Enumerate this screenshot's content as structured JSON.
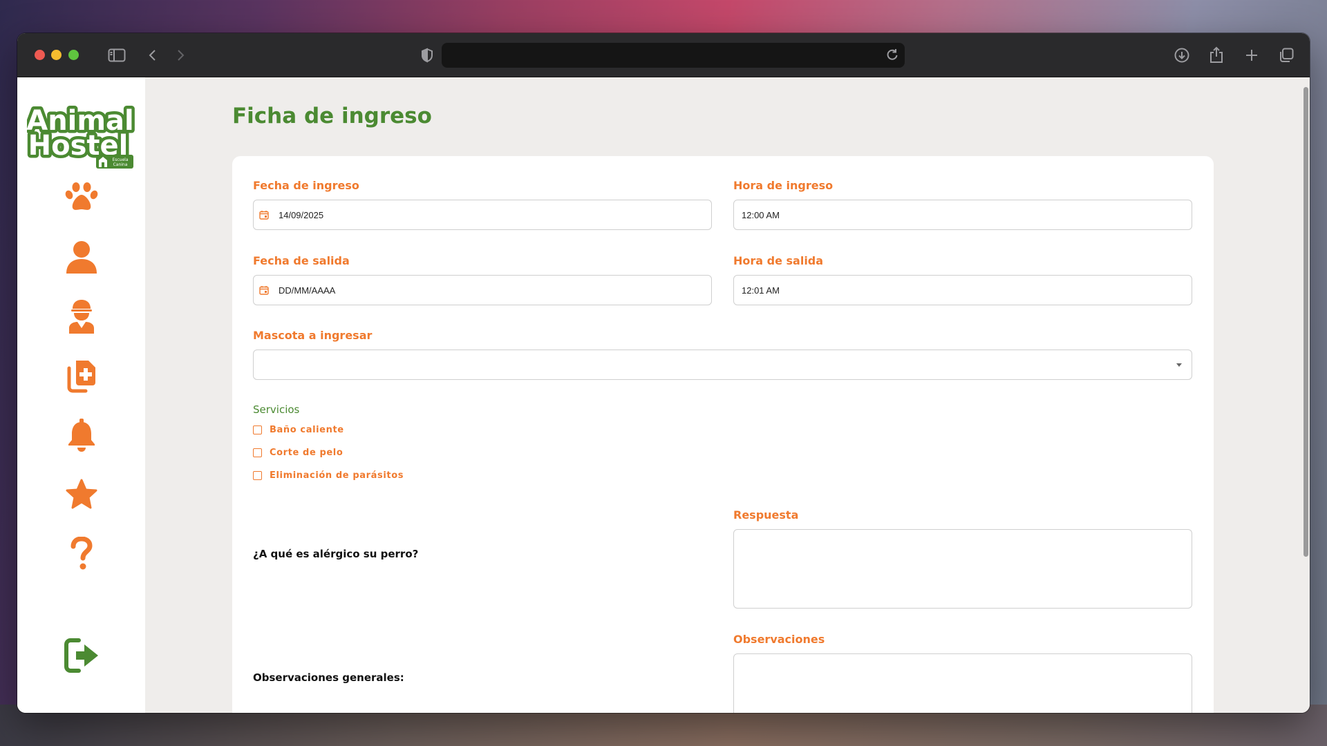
{
  "browser": {
    "address": ""
  },
  "sidebar": {
    "logo": {
      "line1": "Animal",
      "line2": "Hostel",
      "tag1": "Escuela",
      "tag2": "Canina"
    },
    "items": [
      {
        "icon": "paw-icon"
      },
      {
        "icon": "user-icon"
      },
      {
        "icon": "staff-icon"
      },
      {
        "icon": "medical-records-icon"
      },
      {
        "icon": "bell-icon"
      },
      {
        "icon": "star-icon"
      },
      {
        "icon": "help-icon"
      }
    ],
    "logout_icon": "logout-icon"
  },
  "colors": {
    "accent_orange": "#f07a2e",
    "brand_green": "#4b8a32"
  },
  "page": {
    "title": "Ficha de ingreso"
  },
  "form": {
    "fecha_ingreso": {
      "label": "Fecha de ingreso",
      "value": "14/09/2025"
    },
    "hora_ingreso": {
      "label": "Hora de ingreso",
      "value": "12:00 AM"
    },
    "fecha_salida": {
      "label": "Fecha de salida",
      "placeholder": "DD/MM/AAAA"
    },
    "hora_salida": {
      "label": "Hora de salida",
      "value": "12:01 AM"
    },
    "mascota": {
      "label": "Mascota a ingresar",
      "value": ""
    },
    "servicios": {
      "label": "Servicios",
      "options": [
        {
          "label": "Baño caliente",
          "checked": false
        },
        {
          "label": "Corte de pelo",
          "checked": false
        },
        {
          "label": "Eliminación de parásitos",
          "checked": false
        }
      ]
    },
    "alergias": {
      "question": "¿A qué es alérgico su perro?",
      "answer_label": "Respuesta",
      "answer": ""
    },
    "observaciones": {
      "question": "Observaciones generales:",
      "answer_label": "Observaciones",
      "answer": ""
    }
  }
}
